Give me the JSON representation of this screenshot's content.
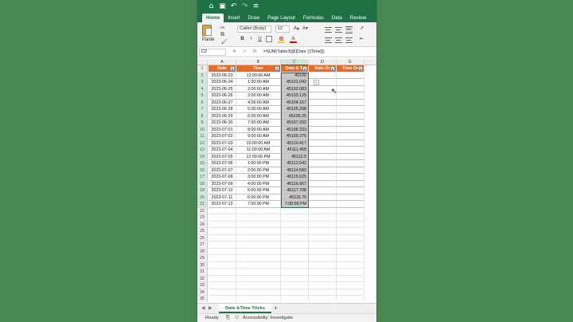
{
  "titlebar": {
    "icons": [
      "home-icon",
      "save-icon",
      "undo-icon",
      "redo-icon",
      "more-icon"
    ]
  },
  "tabs": [
    "Home",
    "Insert",
    "Draw",
    "Page Layout",
    "Formulas",
    "Data",
    "Review"
  ],
  "ribbon": {
    "paste": "Paste",
    "font": "Calibri (Body)",
    "size": "12",
    "bold": "B",
    "italic": "I",
    "underline": "U",
    "grow": "A▴",
    "shrink": "A▾",
    "font_color": "A",
    "fill_color": "▧"
  },
  "formula_bar": {
    "name_box": "C2",
    "cancel": "✕",
    "confirm": "✓",
    "fx": "fx",
    "formula": "=SUM(Table3[@[Date ]:[Time]])"
  },
  "columns": [
    "A",
    "B",
    "C",
    "D",
    "E"
  ],
  "headers": [
    "Date",
    "Time",
    "Date & Ti",
    "Date Or",
    "Time Or"
  ],
  "rows": [
    [
      "2023-06-23",
      "12:00:00 AM",
      "45100"
    ],
    [
      "2023-06-24",
      "1:00:00 AM",
      "45101.042"
    ],
    [
      "2023-06-25",
      "2:00:00 AM",
      "45102.083"
    ],
    [
      "2023-06-26",
      "3:00:00 AM",
      "45103.125"
    ],
    [
      "2023-06-27",
      "4:00:00 AM",
      "45104.167"
    ],
    [
      "2023-06-28",
      "5:00:00 AM",
      "45105.208"
    ],
    [
      "2023-06-29",
      "6:00:00 AM",
      "45106.25"
    ],
    [
      "2023-06-30",
      "7:00:00 AM",
      "45107.292"
    ],
    [
      "2023-07-01",
      "8:00:00 AM",
      "45108.333"
    ],
    [
      "2023-07-02",
      "9:00:00 AM",
      "45109.375"
    ],
    [
      "2023-07-03",
      "10:00:00 AM",
      "45110.417"
    ],
    [
      "2023-07-04",
      "11:00:00 AM",
      "45111.458"
    ],
    [
      "2023-07-05",
      "12:00:00 PM",
      "45112.5"
    ],
    [
      "2023-07-06",
      "1:00:00 PM",
      "45113.542"
    ],
    [
      "2023-07-07",
      "2:00:00 PM",
      "45114.583"
    ],
    [
      "2023-07-08",
      "3:00:00 PM",
      "45115.625"
    ],
    [
      "2023-07-09",
      "4:00:00 PM",
      "45116.667"
    ],
    [
      "2023-07-10",
      "5:00:00 PM",
      "45117.708"
    ],
    [
      "2023-07-11",
      "6:00:00 PM",
      "45118.75"
    ],
    [
      "2023-07-12",
      "7:00:00 PM",
      "7:00:00 PM"
    ]
  ],
  "row_count": 37,
  "sheet_tab": "Date &Time Tricks",
  "status": {
    "ready": "Ready",
    "accessibility": "Accessibility: Investigate"
  },
  "colors": {
    "excel_green": "#1e7145",
    "header_orange": "#e26d2b",
    "background": "#4a8654"
  }
}
